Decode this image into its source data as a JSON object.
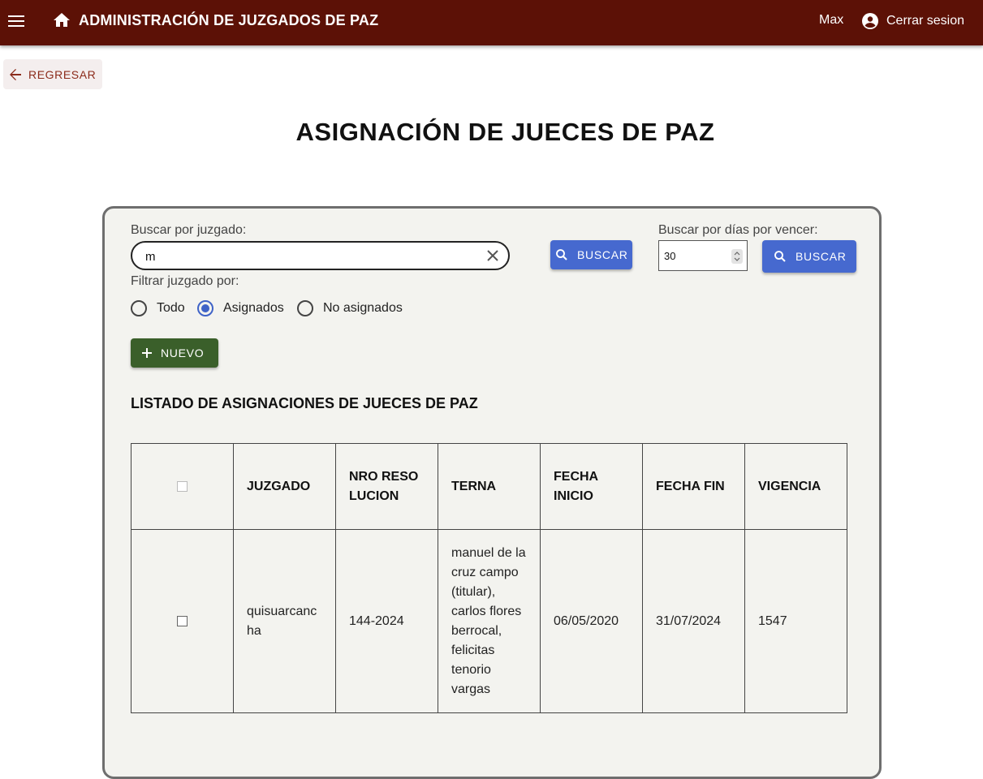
{
  "appbar": {
    "title": "ADMINISTRACIÓN DE JUZGADOS DE PAZ",
    "username": "Max",
    "logout_label": "Cerrar sesion",
    "background": "#5c1106"
  },
  "back_button": {
    "label": "REGRESAR"
  },
  "page_title": "ASIGNACIÓN DE JUECES DE PAZ",
  "filters": {
    "search_label": "Buscar por juzgado:",
    "search_value": "m",
    "search_button": "BUSCAR",
    "days_label": "Buscar por días por vencer:",
    "days_value": "30",
    "days_button": "BUSCAR",
    "filter_label": "Filtrar juzgado por:",
    "radio_options": [
      "Todo",
      "Asignados",
      "No asignados"
    ],
    "radio_selected": "Asignados"
  },
  "new_button": "NUEVO",
  "list_title": "LISTADO DE ASIGNACIONES DE JUECES DE PAZ",
  "table": {
    "headers": [
      "JUZGADO",
      "NRO RESOLUCION",
      "TERNA",
      "FECHA INICIO",
      "FECHA FIN",
      "VIGENCIA"
    ],
    "rows": [
      {
        "juzgado": "quisuarcancha",
        "nro_resolucion": "144-2024",
        "terna": "manuel de la cruz campo (titular), carlos flores berrocal, felicitas tenorio vargas",
        "fecha_inicio": "06/05/2020",
        "fecha_fin": "31/07/2024",
        "vigencia": "1547"
      }
    ]
  },
  "colors": {
    "primary_blue": "#4669cf",
    "new_green": "#3a5f2a",
    "accent_red": "#8b2a1a"
  }
}
